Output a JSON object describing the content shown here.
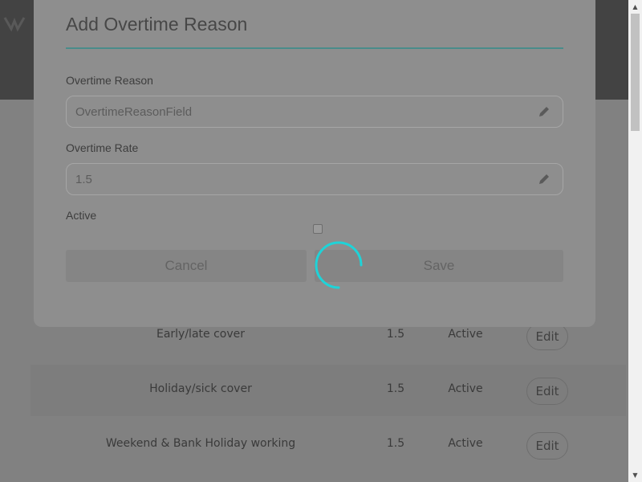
{
  "modal": {
    "title": "Add Overtime Reason",
    "reason_label": "Overtime Reason",
    "reason_value": "OvertimeReasonField",
    "rate_label": "Overtime Rate",
    "rate_value": "1.5",
    "active_label": "Active",
    "active_checked": false,
    "cancel_label": "Cancel",
    "save_label": "Save",
    "loading": true
  },
  "table": {
    "rows": [
      {
        "name": "Early/late cover",
        "rate": "1.5",
        "status": "Active",
        "action": "Edit"
      },
      {
        "name": "Holiday/sick cover",
        "rate": "1.5",
        "status": "Active",
        "action": "Edit"
      },
      {
        "name": "Weekend & Bank Holiday working",
        "rate": "1.5",
        "status": "Active",
        "action": "Edit"
      }
    ]
  },
  "colors": {
    "accent": "#1fd3d8",
    "overlay": "rgba(0,0,0,0.47)"
  }
}
